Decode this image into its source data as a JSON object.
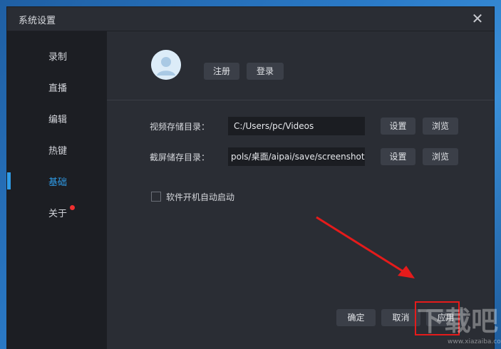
{
  "window": {
    "title": "系统设置"
  },
  "sidebar": {
    "items": [
      {
        "label": "录制"
      },
      {
        "label": "直播"
      },
      {
        "label": "编辑"
      },
      {
        "label": "热键"
      },
      {
        "label": "基础",
        "active": true
      },
      {
        "label": "关于",
        "badge": "red-dot"
      }
    ]
  },
  "account": {
    "register_label": "注册",
    "login_label": "登录"
  },
  "storage": {
    "video_label": "视频存储目录：",
    "video_path": "C:/Users/pc/Videos",
    "screenshot_label": "截屏储存目录：",
    "screenshot_path": "pols/桌面/aipai/save/screenshot",
    "set_label": "设置",
    "browse_label": "浏览"
  },
  "options": {
    "autostart_label": "软件开机自动启动",
    "autostart_checked": false
  },
  "footer": {
    "ok_label": "确定",
    "cancel_label": "取消",
    "apply_label": "应用"
  },
  "annotations": {
    "arrow_color": "#e51b1b",
    "highlight_color": "#e51b1b"
  },
  "watermark": {
    "text": "下载吧",
    "subtext": "www.xiazaiba.com"
  },
  "colors": {
    "accent": "#2f9ce8",
    "badge": "#f03030"
  }
}
